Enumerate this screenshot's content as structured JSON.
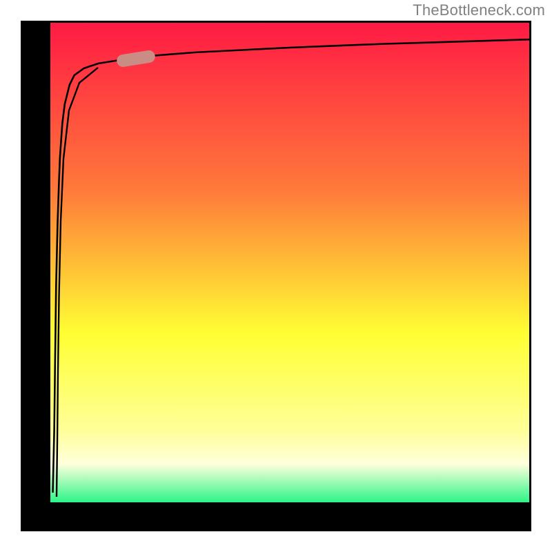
{
  "attribution": "TheBottleneck.com",
  "colors": {
    "frame": "#000000",
    "curve": "#000000",
    "marker": "#c98d86",
    "gradient_top": "#ff1a44",
    "gradient_mid1": "#ff7a3a",
    "gradient_mid2": "#ffff33",
    "gradient_pale": "#ffffcc",
    "gradient_bottom": "#2cf587"
  },
  "chart_data": {
    "type": "line",
    "title": "",
    "xlabel": "",
    "ylabel": "",
    "xlim": [
      0,
      100
    ],
    "ylim": [
      0,
      100
    ],
    "x": [
      0.5,
      0.8,
      1.0,
      1.2,
      1.5,
      1.8,
      2.0,
      2.5,
      3.0,
      4.0,
      5.0,
      7.0,
      10,
      15,
      20,
      30,
      40,
      50,
      60,
      70,
      80,
      90,
      100
    ],
    "values": [
      2,
      15,
      30,
      45,
      58,
      67,
      72,
      79,
      83,
      87,
      89,
      90.5,
      91.5,
      92.3,
      93,
      93.8,
      94.3,
      94.8,
      95.2,
      95.6,
      95.9,
      96.2,
      96.5
    ],
    "marker_segment": {
      "x_start": 18,
      "x_end": 25
    },
    "annotations": []
  }
}
